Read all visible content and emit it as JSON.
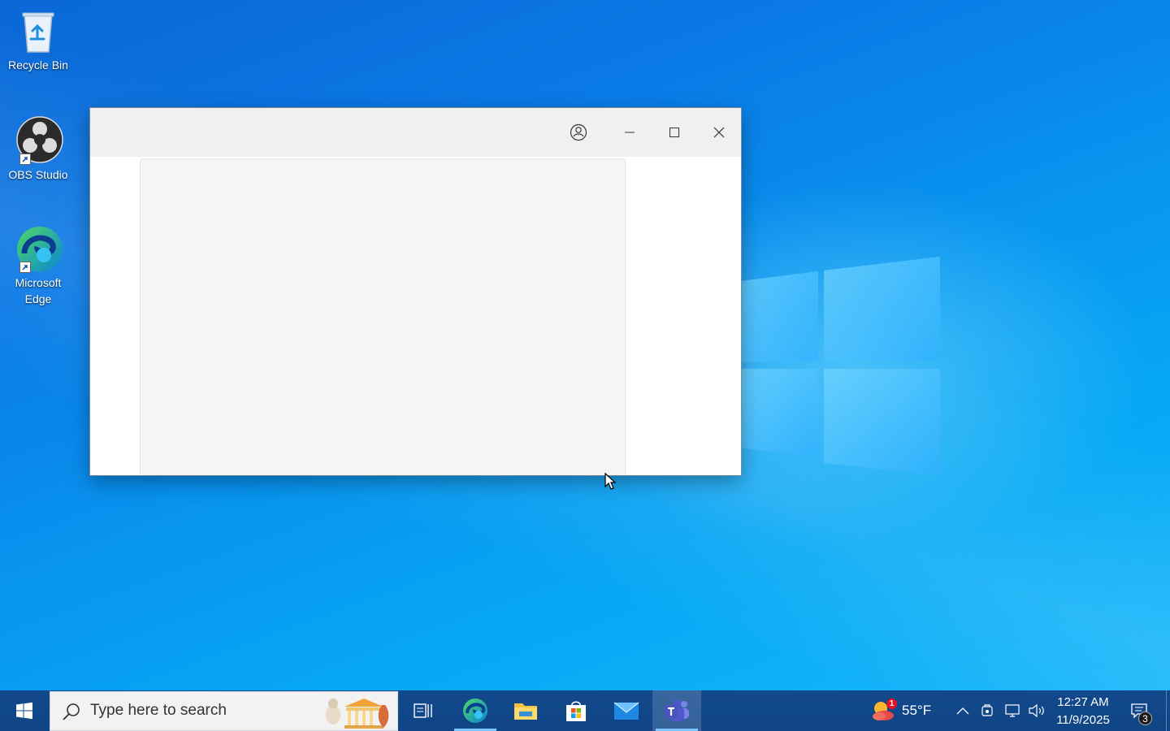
{
  "desktop": {
    "icons": [
      {
        "label": "Recycle Bin",
        "icon": "recycle-bin-icon"
      },
      {
        "label": "OBS Studio",
        "icon": "obs-studio-icon"
      },
      {
        "label": "Microsoft Edge",
        "icon": "edge-icon"
      }
    ]
  },
  "window": {
    "controls": [
      "account-icon",
      "minimize-icon",
      "maximize-icon",
      "close-icon"
    ]
  },
  "taskbar": {
    "search_placeholder": "Type here to search",
    "pinned": [
      "task-view-icon",
      "edge-icon",
      "file-explorer-icon",
      "microsoft-store-icon",
      "mail-icon",
      "teams-icon"
    ],
    "weather": {
      "temperature": "55°F",
      "badge": "1"
    },
    "clock": {
      "time": "12:27 AM",
      "date": "11/9/2025"
    },
    "notifications_count": "3"
  },
  "colors": {
    "accent": "#0a7ae6",
    "taskbar": "#0f4585",
    "running_indicator": "#7cc7ff"
  }
}
